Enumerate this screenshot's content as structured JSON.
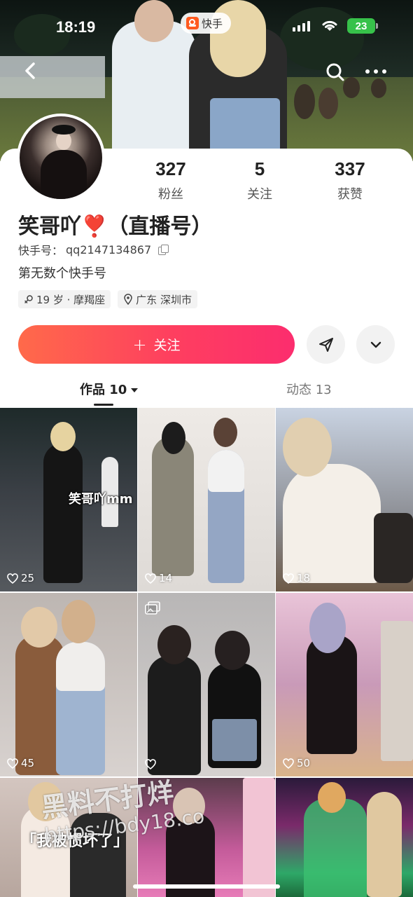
{
  "status": {
    "time": "18:19",
    "app_name": "快手",
    "battery": "23"
  },
  "profile": {
    "followers": "327",
    "followers_label": "粉丝",
    "following": "5",
    "following_label": "关注",
    "likes": "337",
    "likes_label": "获赞",
    "name": "笑哥吖",
    "heart": "❣️",
    "name_suffix": "（直播号）",
    "id_label": "快手号：",
    "id_value": "qq2147134867",
    "bio": "第无数个快手号",
    "tag_age": "19 岁 · 摩羯座",
    "tag_location": "广东 深圳市"
  },
  "actions": {
    "follow_label": "关注"
  },
  "tabs": [
    {
      "label": "作品 10",
      "active": true
    },
    {
      "label": "动态 13",
      "active": false
    }
  ],
  "posts": [
    {
      "likes": "25",
      "caption": "笑哥吖mm"
    },
    {
      "likes": "14"
    },
    {
      "likes": "18"
    },
    {
      "likes": "45"
    },
    {
      "likes": ""
    },
    {
      "likes": "50"
    },
    {
      "likes": "",
      "caption": "「我被惯坏了」"
    },
    {
      "likes": ""
    },
    {
      "likes": ""
    }
  ],
  "watermark": {
    "line1": "黑料不打烊",
    "line2": "https://bdy18.co"
  },
  "icons": [
    "back-icon",
    "search-icon",
    "more-icon",
    "copy-icon",
    "gender-icon",
    "location-icon",
    "share-icon",
    "chevron-down-icon",
    "heart-outline-icon",
    "gallery-icon"
  ],
  "colors": {
    "accent_start": "#ff6a4a",
    "accent_end": "#fc2d6e",
    "battery": "#37c24a",
    "heart": "#e2213a"
  }
}
